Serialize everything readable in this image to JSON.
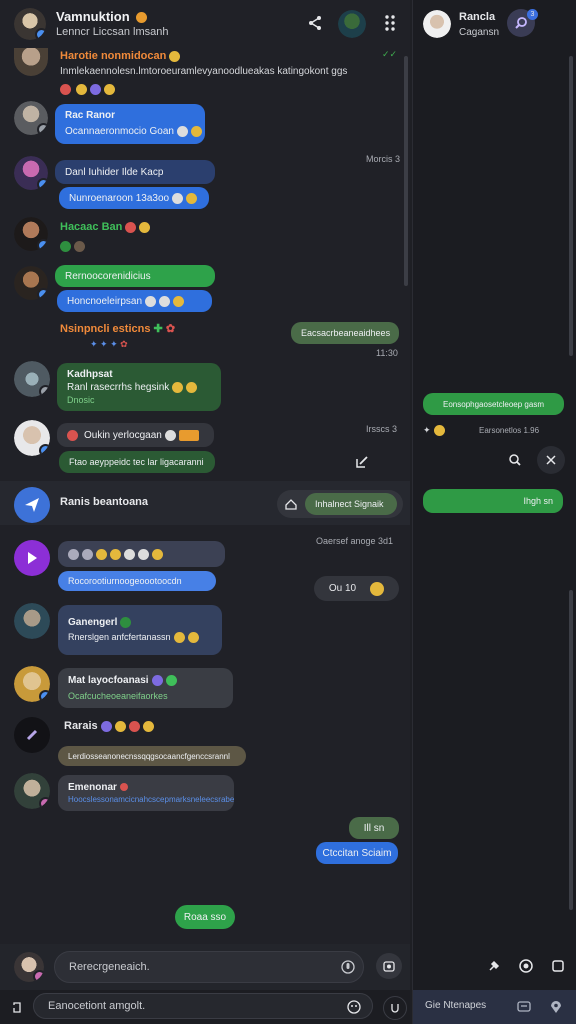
{
  "header": {
    "title": "Vamnuktion",
    "subtitle": "Lenncr Liccsan lmsanh"
  },
  "right": {
    "name": "Rancla",
    "sub": "Cagansn",
    "badge": "3"
  },
  "messages": [
    {
      "name": "Harotie nonmidocan",
      "text": "Inmlekaennolesn.lmtoroeuramlevyanoodlueakas katingokont ggs"
    },
    {
      "name": "Rac Ranor",
      "bubble1": "Ocannaeronmocio Goan"
    },
    {
      "bubble1": "Danl Iuhider Ilde Kacp",
      "bubble2": "Nunroenaroon 13a3oo",
      "time": "Morcis 3"
    },
    {
      "name": "Hacaac Ban"
    },
    {
      "bubble1": "Rernoocorenidicius",
      "bubble2": "Honcnoeleirpsan"
    },
    {
      "name": "Nsinpncli esticns",
      "out": "Eacsacrbeaneaidhees",
      "time": "11:30"
    },
    {
      "name": "Kadhpsat",
      "text": "Ranl rasecrrhs hegsink",
      "bubtext": "Dnosic"
    },
    {
      "text": "Oukin yerlocgaan",
      "bubble2": "Ftao aeyppeidc tec lar ligacaranni",
      "time": "Irsscs 3"
    }
  ],
  "divider": {
    "name": "Ranis beantoana",
    "button": "Inhalnect Signaik",
    "time": "Oaersef anoge 3d1"
  },
  "messages2": [
    {
      "bubble2": "Rocorootiurnoogeoootoocdn"
    },
    {
      "name": "Ganengerl",
      "text": "Rnerslgen anfcfertanassn"
    },
    {
      "name": "Mat layocfoanasi",
      "text": "Ocafcucheoeaneifaorkes"
    },
    {
      "name": "Rarais",
      "bubble2": "Lerdiosseanonecnssqqgsocaancfgenccsrannl"
    },
    {
      "name": "Emenonar",
      "text": "Hoocslessonamcicnahcscepmarksneleecsrabe"
    },
    {
      "out1": "Ill sn",
      "out2": "Ctccitan Sciaim"
    },
    {
      "pill": "Roaa sso"
    }
  ],
  "reactions": {
    "text": "Ou 10"
  },
  "composer": {
    "placeholder": "Rerecrgeneaich.",
    "bottom": "Eanocetiont amgolt."
  },
  "right_msgs": {
    "m1": "Eonsophgaosetcleoep gasm",
    "time": "Earsonetlos 1.96",
    "m2": "Ihgh sn"
  },
  "right_bottom": {
    "label": "Gie Ntenapes"
  }
}
